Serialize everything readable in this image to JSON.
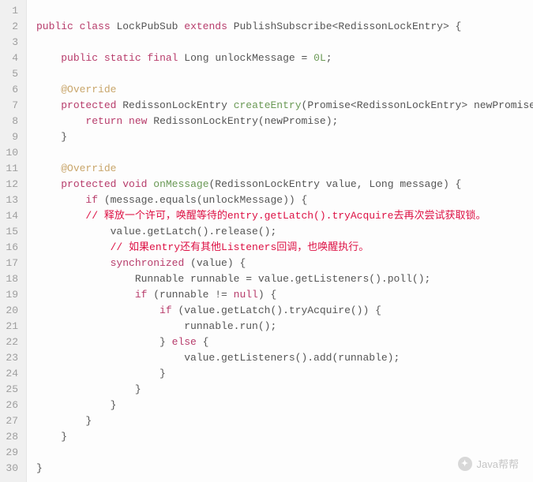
{
  "domain": "Document",
  "code": {
    "lines": [
      {
        "n": 1,
        "ind": 0,
        "tok": []
      },
      {
        "n": 2,
        "ind": 0,
        "tok": [
          [
            "kw",
            "public"
          ],
          [
            "sp",
            " "
          ],
          [
            "kw",
            "class"
          ],
          [
            "sp",
            " "
          ],
          [
            "type",
            "LockPubSub"
          ],
          [
            "sp",
            " "
          ],
          [
            "kw",
            "extends"
          ],
          [
            "sp",
            " "
          ],
          [
            "type",
            "PublishSubscribe<RedissonLockEntry>"
          ],
          [
            "sp",
            " {"
          ]
        ]
      },
      {
        "n": 3,
        "ind": 0,
        "tok": []
      },
      {
        "n": 4,
        "ind": 1,
        "tok": [
          [
            "kw",
            "public"
          ],
          [
            "sp",
            " "
          ],
          [
            "kw",
            "static"
          ],
          [
            "sp",
            " "
          ],
          [
            "kw",
            "final"
          ],
          [
            "sp",
            " "
          ],
          [
            "type",
            "Long"
          ],
          [
            "sp",
            " unlockMessage = "
          ],
          [
            "num",
            "0L"
          ],
          [
            "sp",
            ";"
          ]
        ]
      },
      {
        "n": 5,
        "ind": 0,
        "tok": []
      },
      {
        "n": 6,
        "ind": 1,
        "tok": [
          [
            "annot",
            "@Override"
          ]
        ]
      },
      {
        "n": 7,
        "ind": 1,
        "tok": [
          [
            "kw",
            "protected"
          ],
          [
            "sp",
            " "
          ],
          [
            "type",
            "RedissonLockEntry"
          ],
          [
            "sp",
            " "
          ],
          [
            "mtd",
            "createEntry"
          ],
          [
            "sp",
            "(Promise<RedissonLockEntry> newPromise) {"
          ]
        ]
      },
      {
        "n": 8,
        "ind": 2,
        "tok": [
          [
            "kw",
            "return"
          ],
          [
            "sp",
            " "
          ],
          [
            "kw",
            "new"
          ],
          [
            "sp",
            " "
          ],
          [
            "type",
            "RedissonLockEntry"
          ],
          [
            "sp",
            "(newPromise);"
          ]
        ]
      },
      {
        "n": 9,
        "ind": 1,
        "tok": [
          [
            "sp",
            "}"
          ]
        ]
      },
      {
        "n": 10,
        "ind": 0,
        "tok": []
      },
      {
        "n": 11,
        "ind": 1,
        "tok": [
          [
            "annot",
            "@Override"
          ]
        ]
      },
      {
        "n": 12,
        "ind": 1,
        "tok": [
          [
            "kw",
            "protected"
          ],
          [
            "sp",
            " "
          ],
          [
            "kw",
            "void"
          ],
          [
            "sp",
            " "
          ],
          [
            "mtd",
            "onMessage"
          ],
          [
            "sp",
            "(RedissonLockEntry value, Long message) {"
          ]
        ]
      },
      {
        "n": 13,
        "ind": 2,
        "tok": [
          [
            "kw",
            "if"
          ],
          [
            "sp",
            " (message.equals(unlockMessage)) {"
          ]
        ]
      },
      {
        "n": 14,
        "ind": 2,
        "tok": [
          [
            "comment",
            "// 释放一个许可，唤醒等待的entry.getLatch().tryAcquire去再次尝试获取锁。"
          ]
        ]
      },
      {
        "n": 15,
        "ind": 3,
        "tok": [
          [
            "sp",
            "value.getLatch().release();"
          ]
        ]
      },
      {
        "n": 16,
        "ind": 3,
        "tok": [
          [
            "comment",
            "// 如果entry还有其他Listeners回调，也唤醒执行。"
          ]
        ]
      },
      {
        "n": 17,
        "ind": 3,
        "tok": [
          [
            "kw",
            "synchronized"
          ],
          [
            "sp",
            " (value) {"
          ]
        ]
      },
      {
        "n": 18,
        "ind": 4,
        "tok": [
          [
            "type",
            "Runnable"
          ],
          [
            "sp",
            " runnable = value.getListeners().poll();"
          ]
        ]
      },
      {
        "n": 19,
        "ind": 4,
        "tok": [
          [
            "kw",
            "if"
          ],
          [
            "sp",
            " (runnable != "
          ],
          [
            "kw",
            "null"
          ],
          [
            "sp",
            ") {"
          ]
        ]
      },
      {
        "n": 20,
        "ind": 5,
        "tok": [
          [
            "kw",
            "if"
          ],
          [
            "sp",
            " (value.getLatch().tryAcquire()) {"
          ]
        ]
      },
      {
        "n": 21,
        "ind": 6,
        "tok": [
          [
            "sp",
            "runnable.run();"
          ]
        ]
      },
      {
        "n": 22,
        "ind": 5,
        "tok": [
          [
            "sp",
            "} "
          ],
          [
            "kw",
            "else"
          ],
          [
            "sp",
            " {"
          ]
        ]
      },
      {
        "n": 23,
        "ind": 6,
        "tok": [
          [
            "sp",
            "value.getListeners().add(runnable);"
          ]
        ]
      },
      {
        "n": 24,
        "ind": 5,
        "tok": [
          [
            "sp",
            "}"
          ]
        ]
      },
      {
        "n": 25,
        "ind": 4,
        "tok": [
          [
            "sp",
            "}"
          ]
        ]
      },
      {
        "n": 26,
        "ind": 3,
        "tok": [
          [
            "sp",
            "}"
          ]
        ]
      },
      {
        "n": 27,
        "ind": 2,
        "tok": [
          [
            "sp",
            "}"
          ]
        ]
      },
      {
        "n": 28,
        "ind": 1,
        "tok": [
          [
            "sp",
            "}"
          ]
        ]
      },
      {
        "n": 29,
        "ind": 0,
        "tok": []
      },
      {
        "n": 30,
        "ind": 0,
        "tok": [
          [
            "sp",
            "}"
          ]
        ]
      }
    ]
  },
  "watermark": {
    "text": "Java帮帮"
  }
}
